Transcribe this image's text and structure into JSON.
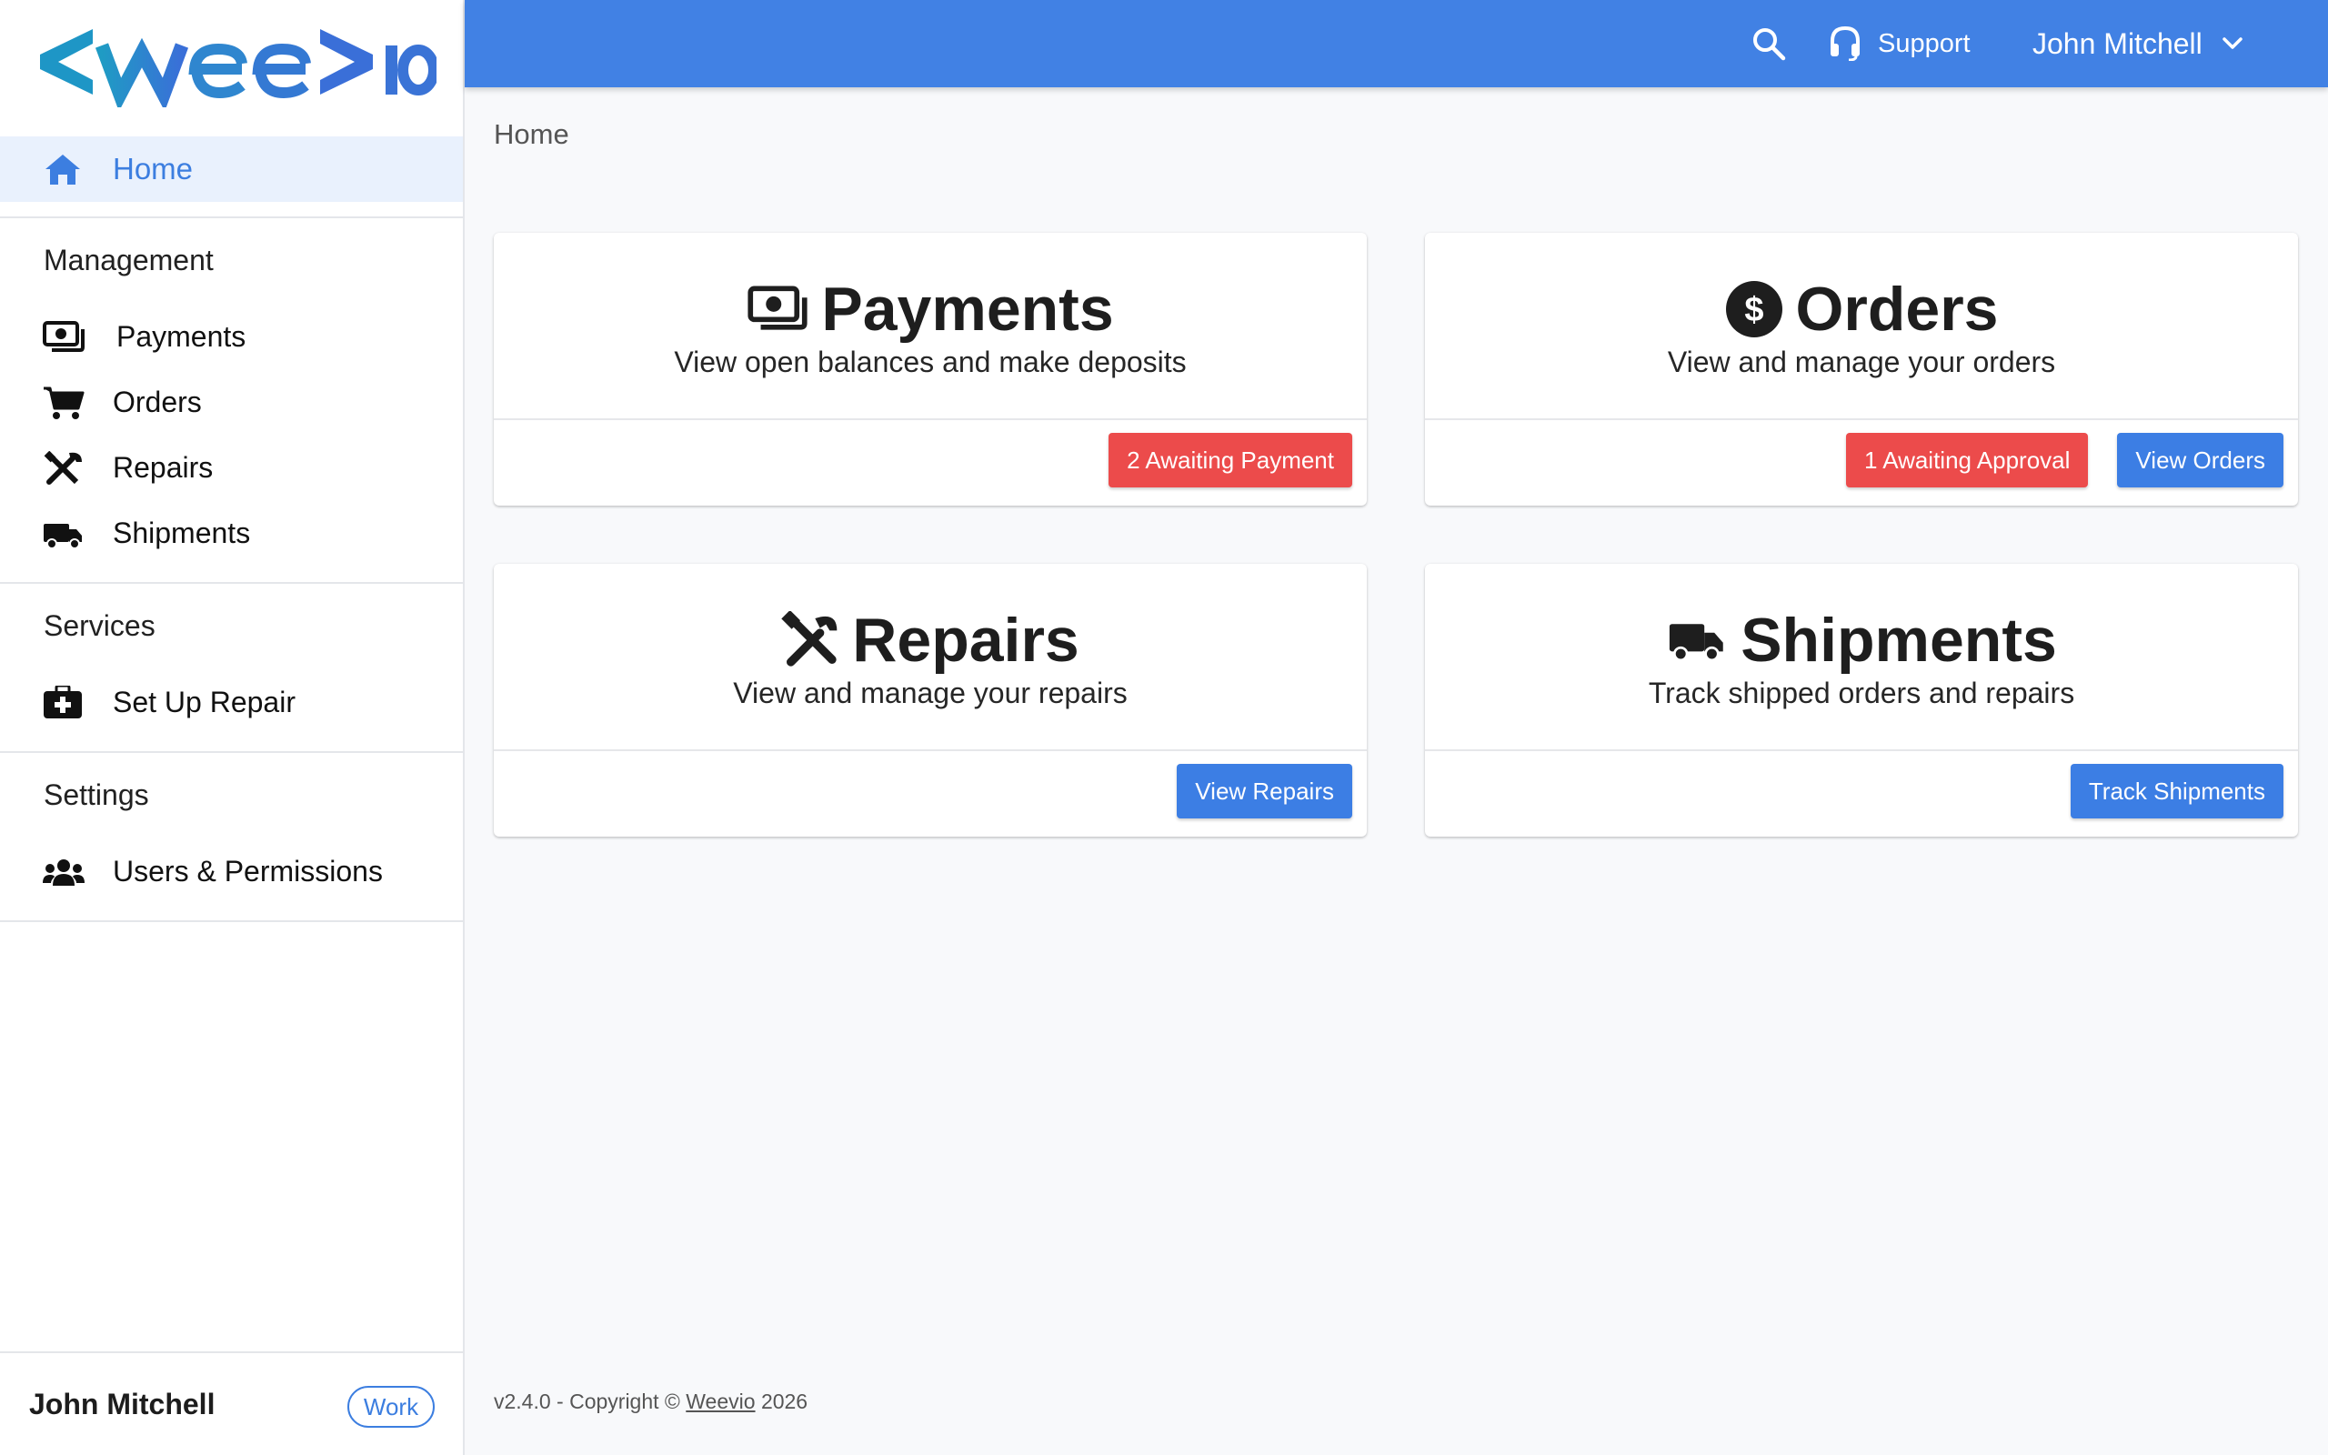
{
  "brand": {
    "logo_text": "<wee>io",
    "primary_color": "#4181e4",
    "logo_color_left": "#1f8fc7",
    "logo_color_right": "#3a73d6"
  },
  "topbar": {
    "search_icon": "search-icon",
    "support_label": "Support",
    "user_name": "John Mitchell"
  },
  "sidebar": {
    "home_label": "Home",
    "sections": [
      {
        "title": "Management",
        "items": [
          {
            "label": "Payments",
            "icon": "money-bill-icon"
          },
          {
            "label": "Orders",
            "icon": "cart-icon"
          },
          {
            "label": "Repairs",
            "icon": "tools-icon"
          },
          {
            "label": "Shipments",
            "icon": "truck-icon"
          }
        ]
      },
      {
        "title": "Services",
        "items": [
          {
            "label": "Set Up Repair",
            "icon": "medkit-icon"
          }
        ]
      },
      {
        "title": "Settings",
        "items": [
          {
            "label": "Users & Permissions",
            "icon": "users-icon"
          }
        ]
      }
    ],
    "footer": {
      "user_name": "John Mitchell",
      "badge": "Work"
    }
  },
  "main": {
    "breadcrumb": "Home",
    "cards": [
      {
        "title": "Payments",
        "subtitle": "View open balances and make deposits",
        "icon": "money-bill-icon",
        "actions": [
          {
            "label": "2 Awaiting Payment",
            "style": "danger",
            "color": "#ec4b4b"
          }
        ]
      },
      {
        "title": "Orders",
        "subtitle": "View and manage your orders",
        "icon": "dollar-circle-icon",
        "actions": [
          {
            "label": "1 Awaiting Approval",
            "style": "danger",
            "color": "#ec4b4b"
          },
          {
            "label": "View Orders",
            "style": "primary",
            "color": "#3c7ee4"
          }
        ]
      },
      {
        "title": "Repairs",
        "subtitle": "View and manage your repairs",
        "icon": "tools-icon",
        "actions": [
          {
            "label": "View Repairs",
            "style": "primary",
            "color": "#3c7ee4"
          }
        ]
      },
      {
        "title": "Shipments",
        "subtitle": "Track shipped orders and repairs",
        "icon": "truck-icon",
        "actions": [
          {
            "label": "Track Shipments",
            "style": "primary",
            "color": "#3c7ee4"
          }
        ]
      }
    ]
  },
  "footer": {
    "version_prefix": "v2.4.0 - Copyright ©",
    "company_link": "Weevio",
    "year": "2026"
  }
}
